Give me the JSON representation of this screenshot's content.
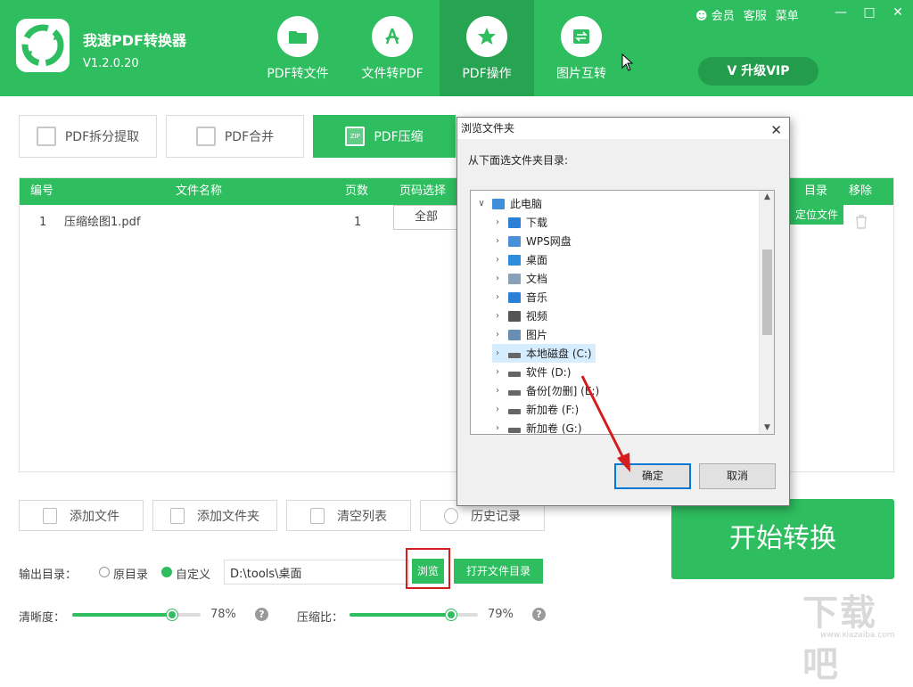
{
  "app": {
    "title": "我速PDF转换器",
    "version": "V1.2.0.20"
  },
  "nav": [
    {
      "label": "PDF转文件",
      "icon": "folder-icon"
    },
    {
      "label": "文件转PDF",
      "icon": "pdf-icon"
    },
    {
      "label": "PDF操作",
      "icon": "star-icon"
    },
    {
      "label": "图片互转",
      "icon": "swap-icon"
    }
  ],
  "topright": {
    "member": "会员",
    "service": "客服",
    "menu": "菜单"
  },
  "vip": {
    "label": "升级VIP"
  },
  "tools": [
    {
      "label": "PDF拆分提取"
    },
    {
      "label": "PDF合并"
    },
    {
      "label": "PDF压缩",
      "badge": "ZIP"
    }
  ],
  "table": {
    "headers": {
      "num": "编号",
      "name": "文件名称",
      "pages": "页数",
      "range": "页码选择",
      "dir": "目录",
      "remove": "移除"
    },
    "rows": [
      {
        "num": "1",
        "name": "压缩绘图1.pdf",
        "pages": "1",
        "range": "全部",
        "locate": "定位文件"
      }
    ]
  },
  "actions": {
    "add_file": "添加文件",
    "add_folder": "添加文件夹",
    "clear": "清空列表",
    "history": "历史记录"
  },
  "start": {
    "label": "开始转换"
  },
  "output": {
    "label": "输出目录：",
    "original": "原目录",
    "custom": "自定义",
    "path": "D:\\tools\\桌面",
    "browse": "浏览",
    "open_dir": "打开文件目录"
  },
  "sliders": {
    "clarity": {
      "label": "清晰度：",
      "value": 78,
      "display": "78%"
    },
    "ratio": {
      "label": "压缩比：",
      "value": 79,
      "display": "79%"
    }
  },
  "watermark": {
    "text": "下载吧",
    "url": "www.xiazaiba.com"
  },
  "dialog": {
    "title": "浏览文件夹",
    "prompt": "从下面选文件夹目录:",
    "tree": [
      {
        "label": "此电脑",
        "icon": "computer-icon",
        "level": 0,
        "expanded": true
      },
      {
        "label": "下载",
        "icon": "download-icon",
        "level": 1
      },
      {
        "label": "WPS网盘",
        "icon": "cloud-icon",
        "level": 1
      },
      {
        "label": "桌面",
        "icon": "desktop-icon",
        "level": 1
      },
      {
        "label": "文档",
        "icon": "document-icon",
        "level": 1
      },
      {
        "label": "音乐",
        "icon": "music-icon",
        "level": 1
      },
      {
        "label": "视频",
        "icon": "video-icon",
        "level": 1
      },
      {
        "label": "图片",
        "icon": "picture-icon",
        "level": 1
      },
      {
        "label": "本地磁盘 (C:)",
        "icon": "drive-icon",
        "level": 1,
        "selected": true
      },
      {
        "label": "软件 (D:)",
        "icon": "drive-icon",
        "level": 1
      },
      {
        "label": "备份[勿删] (E:)",
        "icon": "drive-icon",
        "level": 1
      },
      {
        "label": "新加卷 (F:)",
        "icon": "drive-icon",
        "level": 1
      },
      {
        "label": "新加卷 (G:)",
        "icon": "drive-icon",
        "level": 1
      }
    ],
    "ok": "确定",
    "cancel": "取消"
  },
  "colors": {
    "brand": "#2ebd5f",
    "brand_dark": "#27a451",
    "highlight": "#d41e1e"
  }
}
